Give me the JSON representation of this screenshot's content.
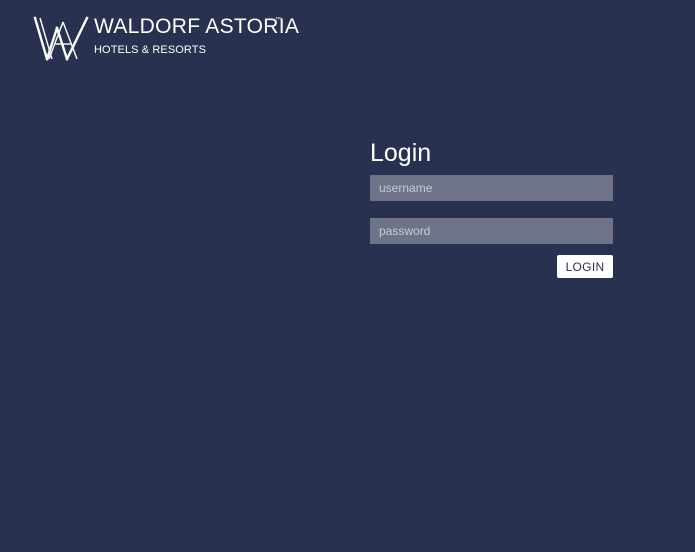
{
  "brand": {
    "name": "WALDORF ASTORIA",
    "trademark": "™",
    "subtitle": "HOTELS & RESORTS",
    "logo_icon": "waldorf-astoria-monogram-icon"
  },
  "login": {
    "title": "Login",
    "username_placeholder": "username",
    "password_placeholder": "password",
    "button_label": "LOGIN"
  },
  "colors": {
    "background": "#283250",
    "field_background": "#6e7387",
    "button_background": "#ffffff",
    "text": "#ffffff"
  }
}
